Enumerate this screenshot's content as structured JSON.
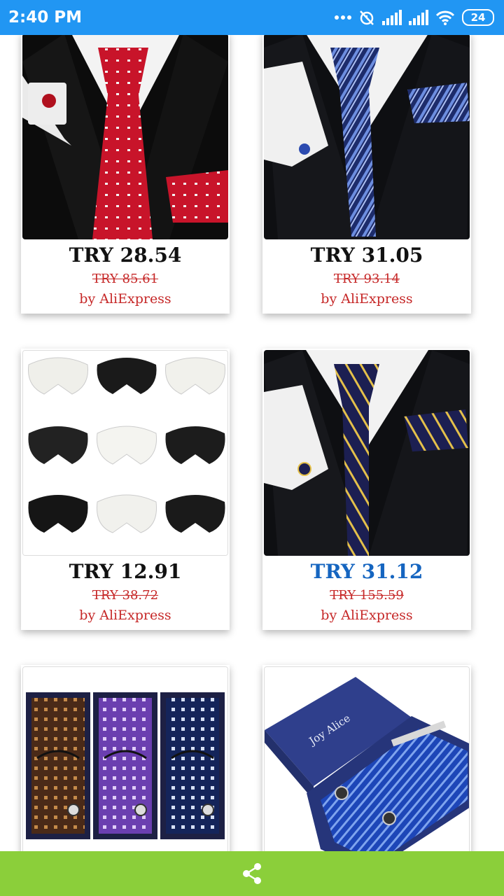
{
  "status_bar": {
    "time": "2:40 PM",
    "battery": "24"
  },
  "products": [
    {
      "price": "TRY 28.54",
      "old_price": "TRY 85.61",
      "seller": "by AliExpress",
      "image": "red-dotted-tie-set"
    },
    {
      "price": "TRY 31.05",
      "old_price": "TRY 93.14",
      "seller": "by AliExpress",
      "image": "blue-striped-tie-set"
    },
    {
      "price": "TRY 12.91",
      "old_price": "TRY 38.72",
      "seller": "by AliExpress",
      "image": "lace-collars-grid"
    },
    {
      "price": "TRY 31.12",
      "old_price": "TRY 155.59",
      "seller": "by AliExpress",
      "image": "navy-gold-striped-tie-set"
    },
    {
      "image": "three-tie-gift-boxes"
    },
    {
      "image": "joy-alice-tie-box",
      "box_brand": "Joy Alice"
    }
  ],
  "colors": {
    "status_bar": "#2196f3",
    "bottom_bar": "#8bcf3a",
    "price_accent": "#1565c0",
    "old_price": "#c62828"
  },
  "bottom_bar": {
    "icon": "share-icon"
  }
}
